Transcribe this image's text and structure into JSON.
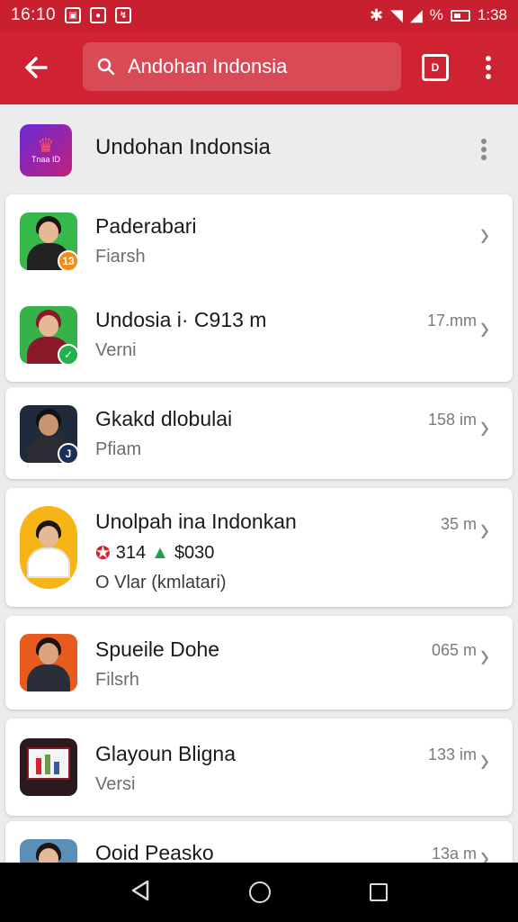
{
  "status_bar": {
    "time_left": "16:10",
    "battery_percent": "%",
    "time_right": "1:38"
  },
  "app_bar": {
    "back_icon": "arrow-back-icon",
    "search_text": "Andohan Indonsia",
    "tab_icon_label": "D"
  },
  "header": {
    "title": "Undohan Indonsia",
    "logo_text": "Tnaa ID"
  },
  "items": [
    {
      "title": "Paderabari",
      "subtitle": "Fiarsh",
      "meta": "",
      "avatar_bg": "#37b84a",
      "badge_color": "#f28c1b",
      "badge_glyph": "13"
    },
    {
      "title": "Undosia i· C913 m",
      "subtitle": "Verni",
      "meta": "17.mm",
      "avatar_bg": "#35b34a",
      "badge_color": "#23b14d",
      "badge_glyph": "✓"
    },
    {
      "title": "Gkakd dlobulai",
      "subtitle": "Pfiam",
      "meta": "158 im",
      "avatar_bg": "#1f2b3a",
      "badge_color": "#1a2f5a",
      "badge_glyph": "J"
    },
    {
      "title": "Unolpah ina Indonkan",
      "rating": "314",
      "price": "$030",
      "subtitle": "O Vlar (kmlatari)",
      "meta": "35 m",
      "avatar_bg": "#f6b417"
    },
    {
      "title": "Spueile Dohe",
      "subtitle": "Filsrh",
      "meta": "065 m",
      "avatar_bg": "#e85a1e"
    },
    {
      "title": "Glayoun Bligna",
      "subtitle": "Versi",
      "meta": "133 im",
      "avatar_bg": "#2a1a20"
    },
    {
      "title": "Ooid Peasko",
      "subtitle": "",
      "meta": "13a m",
      "avatar_bg": "#5a90b8"
    }
  ]
}
